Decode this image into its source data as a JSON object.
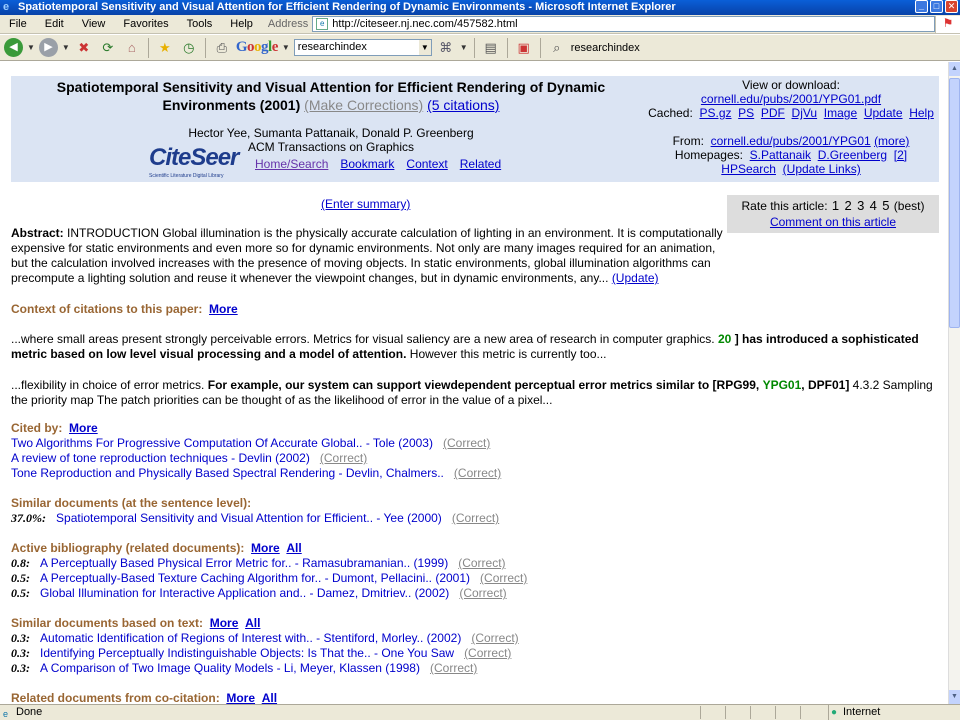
{
  "window": {
    "title": "Spatiotemporal Sensitivity and Visual Attention for Efficient Rendering of Dynamic Environments - Microsoft Internet Explorer"
  },
  "menubar": {
    "items": [
      "File",
      "Edit",
      "View",
      "Favorites",
      "Tools",
      "Help"
    ],
    "address_label": "Address",
    "url": "http://citeseer.nj.nec.com/457582.html"
  },
  "toolbar": {
    "google_label": "Google",
    "search_value": "researchindex",
    "bookmark_label": "researchindex"
  },
  "header": {
    "title_line1": "Spatiotemporal Sensitivity and Visual Attention for Efficient Rendering of Dynamic",
    "title_line2": "Environments (2001)",
    "make_corrections": "(Make Corrections)",
    "citations": "(5 citations)",
    "authors": "Hector Yee, Sumanta Pattanaik, Donald P. Greenberg",
    "journal": "ACM Transactions on Graphics",
    "logo": "CiteSeer",
    "logo_sub": "Scientific Literature Digital Library",
    "nav": [
      "Home/Search",
      "Bookmark",
      "Context",
      "Related"
    ],
    "view_label": "View or download:",
    "pdf_link": "cornell.edu/pubs/2001/YPG01.pdf",
    "cached_label": "Cached:",
    "cached_links": [
      "PS.gz",
      "PS",
      "PDF",
      "DjVu",
      "Image",
      "Update",
      "Help"
    ],
    "from_label": "From:",
    "from_link": "cornell.edu/pubs/2001/YPG01",
    "from_more": "(more)",
    "homepages_label": "Homepages:",
    "homepage_links": [
      "S.Pattanaik",
      "D.Greenberg",
      "[2]"
    ],
    "hpsearch": "HPSearch",
    "update_links": "(Update Links)"
  },
  "summary": {
    "enter_summary": "(Enter summary)",
    "rate_label": "Rate this article:",
    "rate_values": [
      "1",
      "2",
      "3",
      "4",
      "5"
    ],
    "rate_best": "(best)",
    "comment": "Comment on this article"
  },
  "abstract": {
    "label": "Abstract:",
    "text": "INTRODUCTION Global illumination is the physically accurate calculation of lighting in an environment. It is computationally expensive for static environments and even more so for dynamic environments. Not only are many images required for an animation, but the calculation involved increases with the presence of moving objects. In static environments, global illumination algorithms can precompute a lighting solution and reuse it whenever the viewpoint changes, but in dynamic environments, any...",
    "update": "(Update)"
  },
  "context": {
    "heading": "Context of citations to this paper:",
    "more": "More",
    "snip1_pre": "...where small areas present strongly perceivable errors. Metrics for visual saliency are a new area of research in computer graphics.",
    "snip1_num": "20",
    "snip1_bold": "] has introduced a sophisticated metric based on low level visual processing and a model of attention.",
    "snip1_post": "However this metric is currently too...",
    "snip2_pre": "...flexibility in choice of error metrics.",
    "snip2_bold": "For example, our system can support viewdependent perceptual error metrics similar to [RPG99,",
    "snip2_green": "YPG01",
    "snip2_bold2": ", DPF01]",
    "snip2_post": "4.3.2 Sampling the priority map The patch priorities can be thought of as the likelihood of error in the value of a pixel..."
  },
  "cited_by": {
    "heading": "Cited by:",
    "more": "More",
    "items": [
      "Two Algorithms For Progressive Computation Of Accurate Global.. - Tole (2003)",
      "A review of tone reproduction techniques - Devlin (2002)",
      "Tone Reproduction and Physically Based Spectral Rendering - Devlin, Chalmers.."
    ],
    "correct": "(Correct)"
  },
  "similar_sentence": {
    "heading": "Similar documents (at the sentence level):",
    "score": "37.0%:",
    "item": "Spatiotemporal Sensitivity and Visual Attention for Efficient.. - Yee (2000)",
    "correct": "(Correct)"
  },
  "active_bib": {
    "heading": "Active bibliography (related documents):",
    "more": "More",
    "all": "All",
    "items": [
      {
        "score": "0.8:",
        "text": "A Perceptually Based Physical Error Metric for.. - Ramasubramanian.. (1999)"
      },
      {
        "score": "0.5:",
        "text": "A Perceptually-Based Texture Caching Algorithm for.. - Dumont, Pellacini.. (2001)"
      },
      {
        "score": "0.5:",
        "text": "Global Illumination for Interactive Application and.. - Damez, Dmitriev.. (2002)"
      }
    ],
    "correct": "(Correct)"
  },
  "similar_text": {
    "heading": "Similar documents based on text:",
    "more": "More",
    "all": "All",
    "items": [
      {
        "score": "0.3:",
        "text": "Automatic Identification of Regions of Interest with.. - Stentiford, Morley.. (2002)"
      },
      {
        "score": "0.3:",
        "text": "Identifying Perceptually Indistinguishable Objects: Is That the.. - One You Saw"
      },
      {
        "score": "0.3:",
        "text": "A Comparison of Two Image Quality Models - Li, Meyer, Klassen (1998)"
      }
    ],
    "correct": "(Correct)"
  },
  "cocitation": {
    "heading": "Related documents from co-citation:",
    "more": "More",
    "all": "All"
  },
  "status": {
    "text": "Done",
    "zone": "Internet"
  }
}
